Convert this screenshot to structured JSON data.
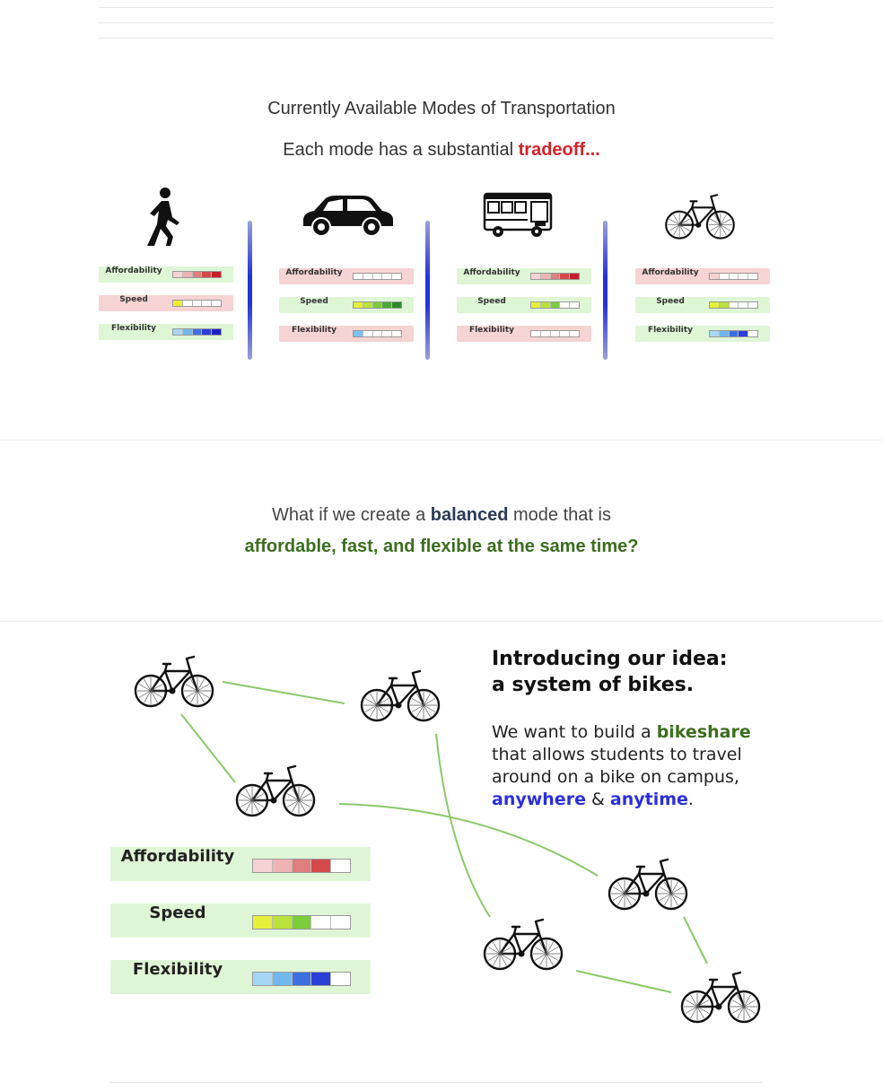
{
  "section1": {
    "title": "Currently Available Modes of Transportation",
    "subtitle_prefix": "Each mode has a substantial ",
    "subtitle_emph": "tradeoff...",
    "modes": [
      {
        "icon": "walking-person-icon",
        "rows": [
          {
            "label": "Affordability",
            "tone": "good",
            "cells": [
              "#f6d2d2",
              "#eeb3b3",
              "#e07d7d",
              "#d44a4a",
              "#c71f2a"
            ]
          },
          {
            "label": "Speed",
            "tone": "bad",
            "cells": [
              "#f0ec34",
              "#ffffff",
              "#ffffff",
              "#ffffff",
              "#ffffff"
            ]
          },
          {
            "label": "Flexibility",
            "tone": "good",
            "cells": [
              "#a6d6f4",
              "#72b8ec",
              "#3e6fe0",
              "#2a3fd8",
              "#1c22c6"
            ]
          }
        ]
      },
      {
        "icon": "car-icon",
        "rows": [
          {
            "label": "Affordability",
            "tone": "bad",
            "cells": [
              "#ffffff",
              "#ffffff",
              "#ffffff",
              "#ffffff",
              "#ffffff"
            ]
          },
          {
            "label": "Speed",
            "tone": "good",
            "cells": [
              "#e6ef3a",
              "#b9e23b",
              "#7ccc3b",
              "#4daa33",
              "#2e8b2a"
            ]
          },
          {
            "label": "Flexibility",
            "tone": "bad",
            "cells": [
              "#7fc2ef",
              "#ffffff",
              "#ffffff",
              "#ffffff",
              "#ffffff"
            ]
          }
        ]
      },
      {
        "icon": "bus-icon",
        "rows": [
          {
            "label": "Affordability",
            "tone": "good",
            "cells": [
              "#f6d2d2",
              "#eeb3b3",
              "#e07d7d",
              "#d44a4a",
              "#c71f2a"
            ]
          },
          {
            "label": "Speed",
            "tone": "good",
            "cells": [
              "#e6ef3a",
              "#b9e23b",
              "#7ccc3b",
              "#ffffff",
              "#ffffff"
            ]
          },
          {
            "label": "Flexibility",
            "tone": "bad",
            "cells": [
              "#ffffff",
              "#ffffff",
              "#ffffff",
              "#ffffff",
              "#ffffff"
            ]
          }
        ]
      },
      {
        "icon": "bicycle-icon",
        "rows": [
          {
            "label": "Affordability",
            "tone": "bad",
            "cells": [
              "#f6d2d2",
              "#ffffff",
              "#ffffff",
              "#ffffff",
              "#ffffff"
            ]
          },
          {
            "label": "Speed",
            "tone": "good",
            "cells": [
              "#e6ef3a",
              "#b9e23b",
              "#ffffff",
              "#ffffff",
              "#ffffff"
            ]
          },
          {
            "label": "Flexibility",
            "tone": "good",
            "cells": [
              "#a6d6f4",
              "#72b8ec",
              "#3e6fe0",
              "#2a3fd8",
              "#ffffff"
            ]
          }
        ]
      }
    ]
  },
  "section2": {
    "line1_prefix": "What if we create a ",
    "line1_emph": "balanced",
    "line1_suffix": " mode that is",
    "line2": "affordable, fast, and flexible at the same time?"
  },
  "section3": {
    "heading1": "Introducing our idea:",
    "heading2": "a system of bikes.",
    "p_prefix": "We want to build a ",
    "p_emph": "bikeshare",
    "p_line2": "that allows students to travel",
    "p_line3": "around on a bike on campus,",
    "p_anywhere": "anywhere",
    "p_amp": " & ",
    "p_anytime": "anytime",
    "p_period": ".",
    "rows": [
      {
        "label": "Affordability",
        "cells": [
          "#f6d2d2",
          "#eeb3b3",
          "#e07d7d",
          "#d44a4a",
          "#ffffff"
        ]
      },
      {
        "label": "Speed",
        "cells": [
          "#e6ef3a",
          "#b9e23b",
          "#7ccc3b",
          "#ffffff",
          "#ffffff"
        ]
      },
      {
        "label": "Flexibility",
        "cells": [
          "#a6d6f4",
          "#72b8ec",
          "#3e6fe0",
          "#2a3fd8",
          "#ffffff"
        ]
      }
    ]
  },
  "colors": {
    "red": "#d3232a",
    "green": "#3c6d1f",
    "blue": "#2a2fe0",
    "navy": "#2b3a55",
    "row_good": "#dff6d6",
    "row_bad": "#f6d4d4"
  }
}
